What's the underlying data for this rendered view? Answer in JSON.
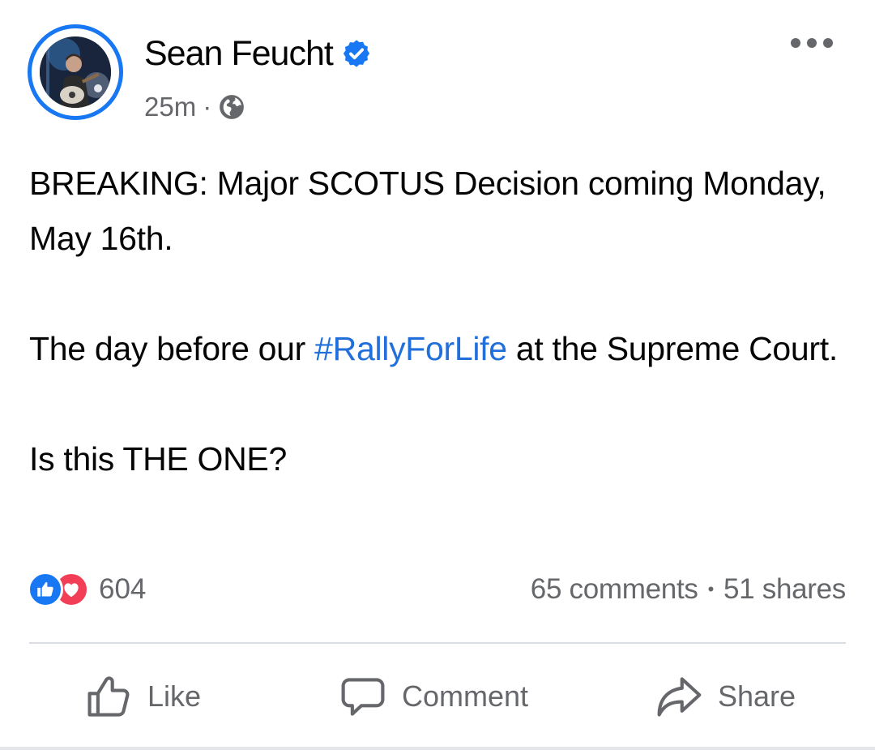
{
  "post": {
    "author": {
      "name": "Sean Feucht",
      "verified_icon": "verified-badge-icon",
      "avatar_icon": "profile-photo"
    },
    "meta": {
      "time": "25m",
      "separator": "·",
      "audience_icon": "globe-icon"
    },
    "body": {
      "line1": "BREAKING: Major SCOTUS Decision coming Monday, May 16th.",
      "line2_before": "The day before our ",
      "hashtag": "#RallyForLife",
      "line2_after": " at the Supreme Court.",
      "line3": "Is this THE ONE?"
    },
    "reactions": {
      "types": [
        "like",
        "love"
      ],
      "count": "604"
    },
    "stats": {
      "comments": "65 comments",
      "separator": "•",
      "shares": "51 shares"
    },
    "actions": {
      "like_label": "Like",
      "comment_label": "Comment",
      "share_label": "Share"
    },
    "colors": {
      "accent": "#1877f2",
      "hashtag": "#216fdb",
      "love": "#f33e58",
      "secondary_text": "#65676b",
      "divider": "#dadde1"
    }
  }
}
